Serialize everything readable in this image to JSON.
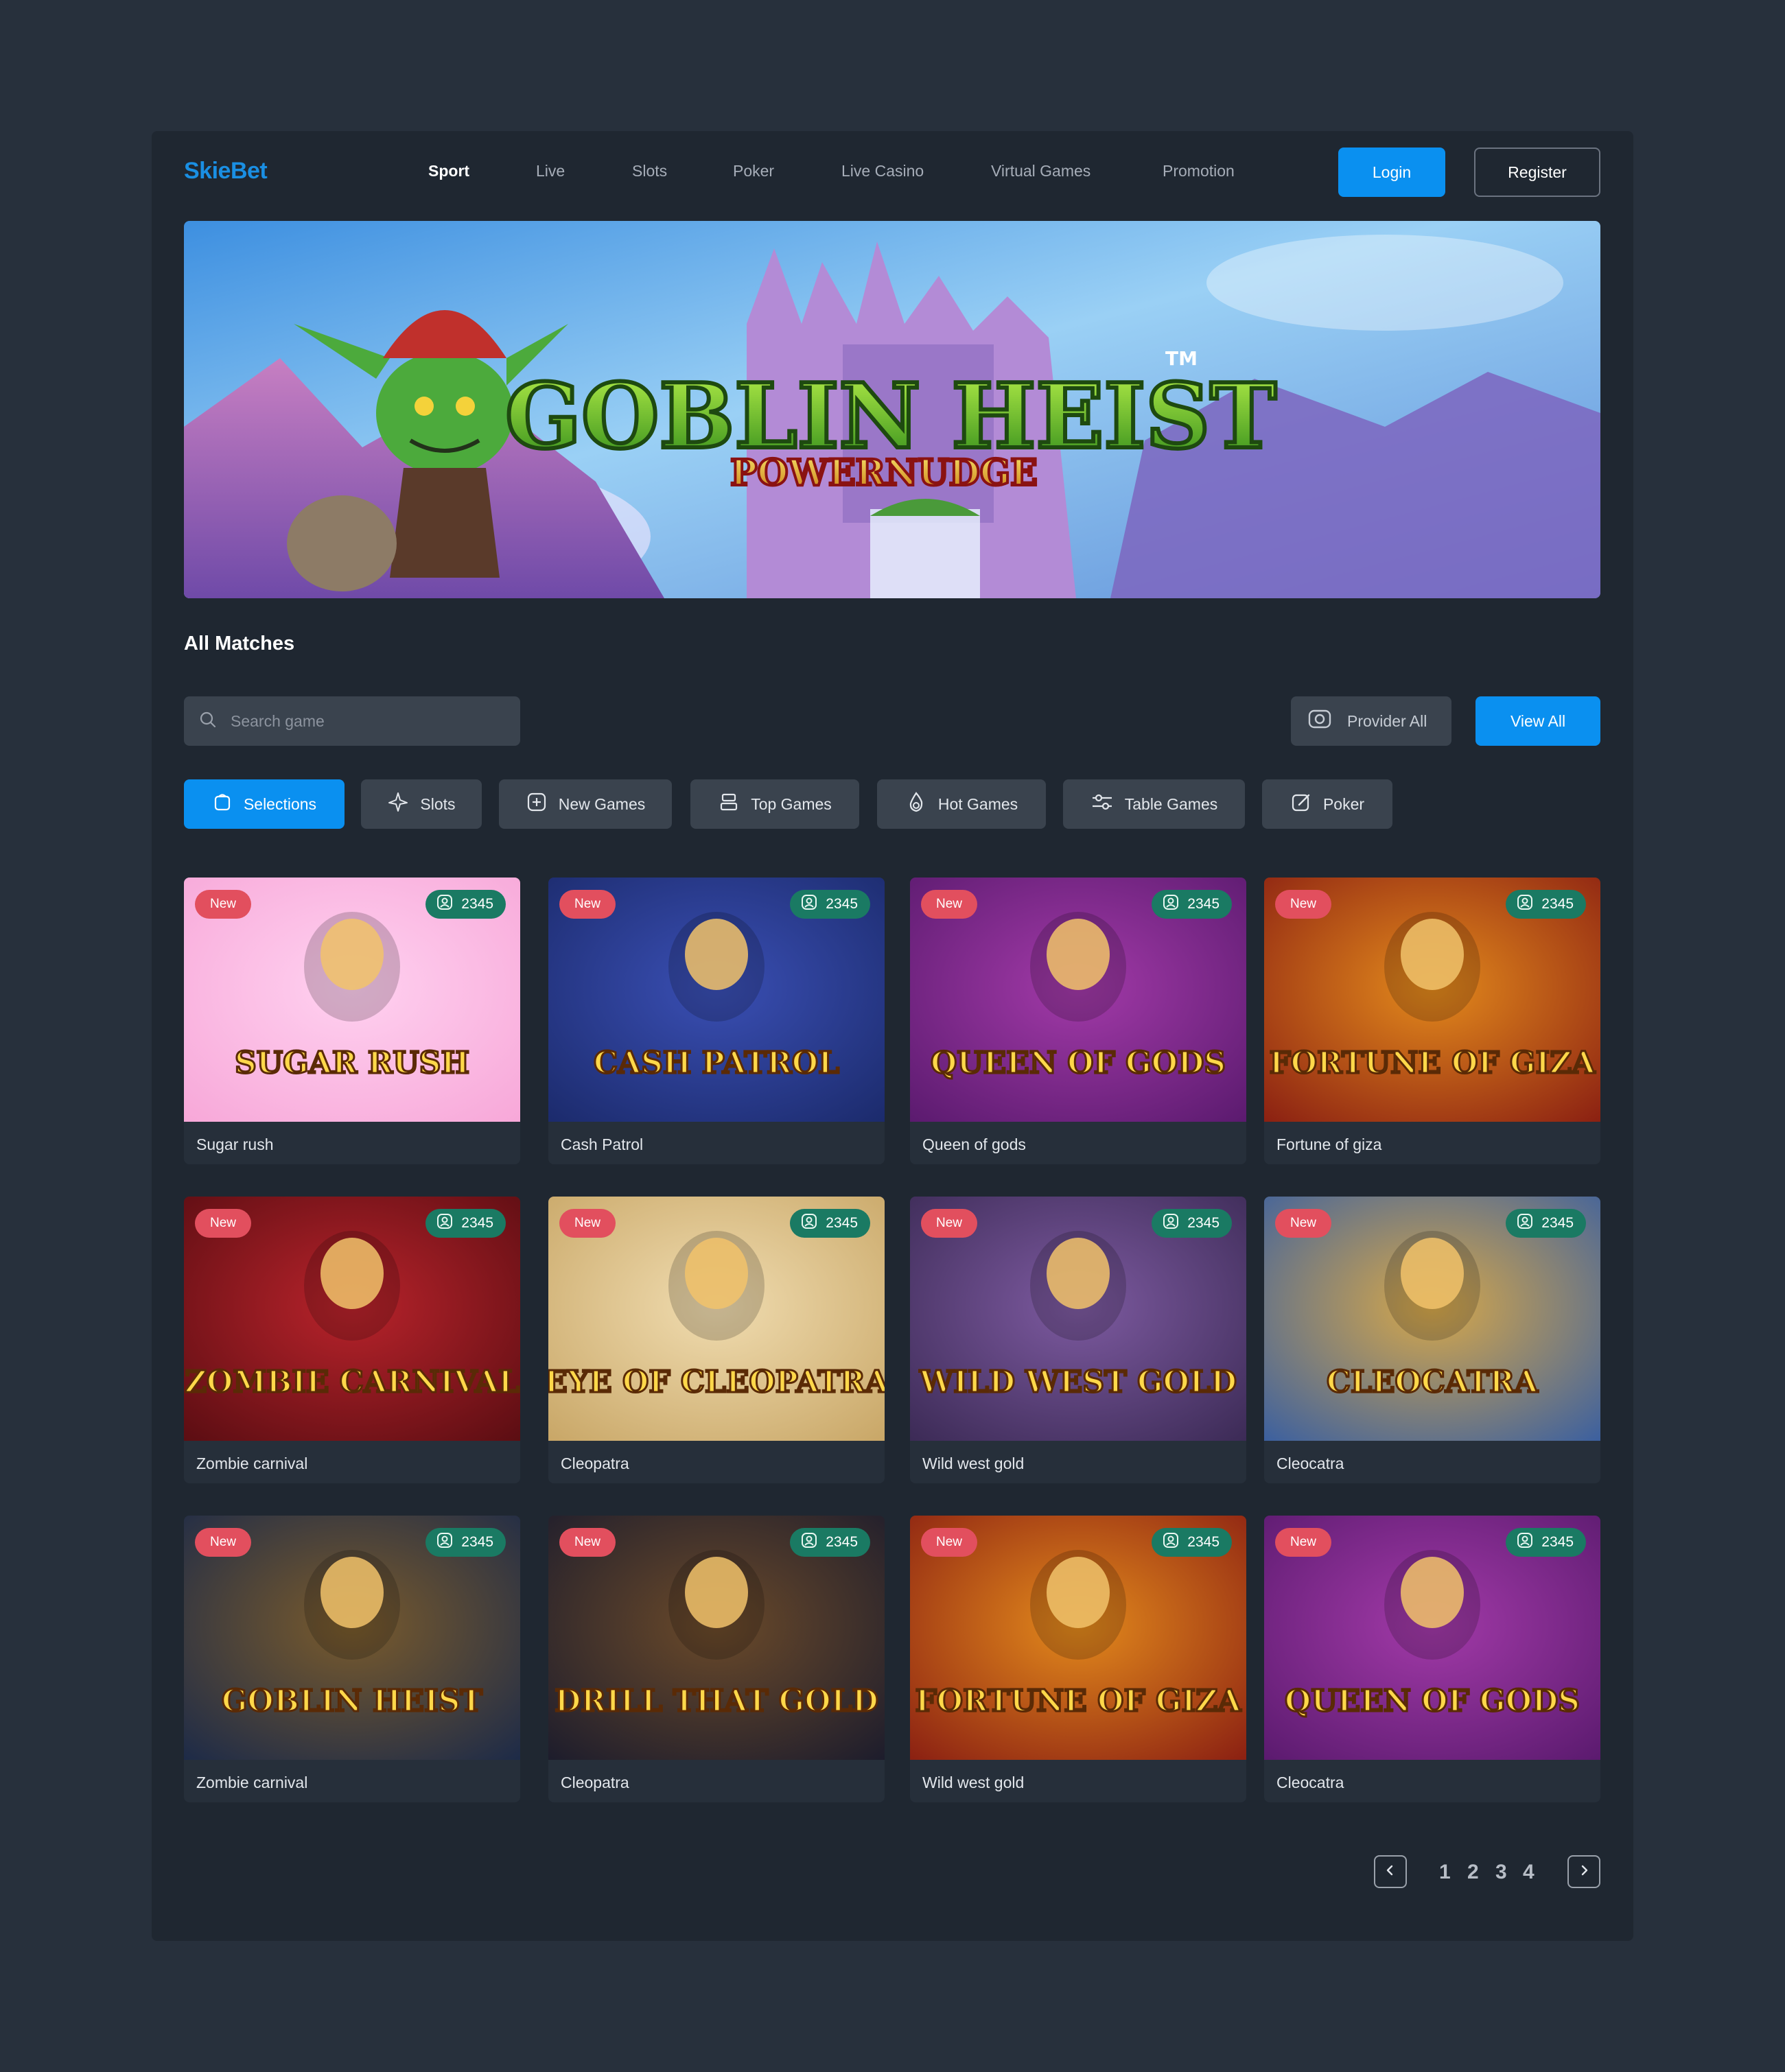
{
  "header": {
    "logo": "SkieBet",
    "nav": [
      "Sport",
      "Live",
      "Slots",
      "Poker",
      "Live Casino",
      "Virtual Games",
      "Promotion"
    ],
    "login": "Login",
    "register": "Register"
  },
  "banner": {
    "title": "GOBLIN HEIST",
    "tm": "TM",
    "subtitle": "POWERNUDGE"
  },
  "section": {
    "title": "All Matches"
  },
  "search": {
    "placeholder": "Search game"
  },
  "provider": "Provider All",
  "view_all": "View All",
  "chips": [
    "Selections",
    "Slots",
    "New Games",
    "Top Games",
    "Hot Games",
    "Table Games",
    "Poker"
  ],
  "cards": [
    {
      "name": "Sugar rush",
      "badge": "New",
      "count": "2345",
      "art": "SUGAR RUSH",
      "colors": [
        "#f7a7d8",
        "#ffd1f0"
      ]
    },
    {
      "name": "Cash Patrol",
      "badge": "New",
      "count": "2345",
      "art": "CASH PATROL",
      "colors": [
        "#1b2a6b",
        "#3a4fb4"
      ]
    },
    {
      "name": "Queen of gods",
      "badge": "New",
      "count": "2345",
      "art": "QUEEN OF GODS",
      "colors": [
        "#5a1a6e",
        "#a23aa8"
      ]
    },
    {
      "name": "Fortune of giza",
      "badge": "New",
      "count": "2345",
      "art": "FORTUNE OF GIZA",
      "colors": [
        "#8a1f12",
        "#e38a1c"
      ]
    },
    {
      "name": "Zombie carnival",
      "badge": "New",
      "count": "2345",
      "art": "ZOMBIE CARNIVAL",
      "colors": [
        "#5a0d12",
        "#b8232b"
      ]
    },
    {
      "name": "Cleopatra",
      "badge": "New",
      "count": "2345",
      "art": "EYE OF CLEOPATRA",
      "colors": [
        "#c8a666",
        "#f0dcb0"
      ]
    },
    {
      "name": "Wild west gold",
      "badge": "New",
      "count": "2345",
      "art": "WILD WEST GOLD",
      "colors": [
        "#3b2a55",
        "#7d5aa0"
      ]
    },
    {
      "name": "Cleocatra",
      "badge": "New",
      "count": "2345",
      "art": "CLEOCATRA",
      "colors": [
        "#3a5fa0",
        "#d7a84a"
      ]
    },
    {
      "name": "Zombie carnival",
      "badge": "New",
      "count": "2345",
      "art": "GOBLIN HEIST",
      "colors": [
        "#1c2a48",
        "#7a5b2c"
      ]
    },
    {
      "name": "Cleopatra",
      "badge": "New",
      "count": "2345",
      "art": "DRILL THAT GOLD",
      "colors": [
        "#1c1c2c",
        "#6b4a2a"
      ]
    },
    {
      "name": "Wild west gold",
      "badge": "New",
      "count": "2345",
      "art": "FORTUNE OF GIZA",
      "colors": [
        "#8a1f12",
        "#e38a1c"
      ]
    },
    {
      "name": "Cleocatra",
      "badge": "New",
      "count": "2345",
      "art": "QUEEN OF GODS",
      "colors": [
        "#5a1a6e",
        "#a23aa8"
      ]
    }
  ],
  "pagination": {
    "pages": [
      "1",
      "2",
      "3",
      "4"
    ]
  },
  "colors": {
    "accent": "#0a90f0",
    "new_badge": "#e24f5e",
    "count_badge": "#1a7a63",
    "panel": "#1f2731",
    "background": "#27303c"
  }
}
